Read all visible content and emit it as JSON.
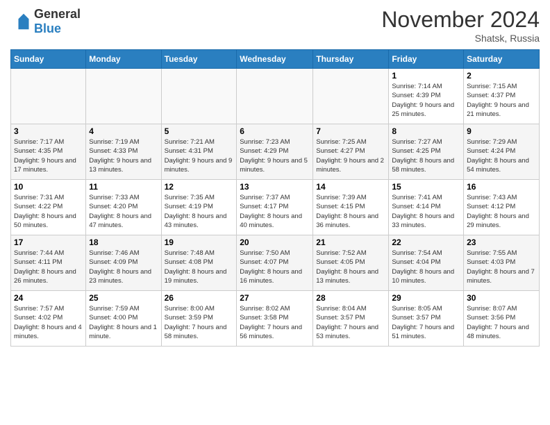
{
  "header": {
    "logo_general": "General",
    "logo_blue": "Blue",
    "month_title": "November 2024",
    "location": "Shatsk, Russia"
  },
  "days_of_week": [
    "Sunday",
    "Monday",
    "Tuesday",
    "Wednesday",
    "Thursday",
    "Friday",
    "Saturday"
  ],
  "weeks": [
    [
      {
        "day": "",
        "info": ""
      },
      {
        "day": "",
        "info": ""
      },
      {
        "day": "",
        "info": ""
      },
      {
        "day": "",
        "info": ""
      },
      {
        "day": "",
        "info": ""
      },
      {
        "day": "1",
        "info": "Sunrise: 7:14 AM\nSunset: 4:39 PM\nDaylight: 9 hours and 25 minutes."
      },
      {
        "day": "2",
        "info": "Sunrise: 7:15 AM\nSunset: 4:37 PM\nDaylight: 9 hours and 21 minutes."
      }
    ],
    [
      {
        "day": "3",
        "info": "Sunrise: 7:17 AM\nSunset: 4:35 PM\nDaylight: 9 hours and 17 minutes."
      },
      {
        "day": "4",
        "info": "Sunrise: 7:19 AM\nSunset: 4:33 PM\nDaylight: 9 hours and 13 minutes."
      },
      {
        "day": "5",
        "info": "Sunrise: 7:21 AM\nSunset: 4:31 PM\nDaylight: 9 hours and 9 minutes."
      },
      {
        "day": "6",
        "info": "Sunrise: 7:23 AM\nSunset: 4:29 PM\nDaylight: 9 hours and 5 minutes."
      },
      {
        "day": "7",
        "info": "Sunrise: 7:25 AM\nSunset: 4:27 PM\nDaylight: 9 hours and 2 minutes."
      },
      {
        "day": "8",
        "info": "Sunrise: 7:27 AM\nSunset: 4:25 PM\nDaylight: 8 hours and 58 minutes."
      },
      {
        "day": "9",
        "info": "Sunrise: 7:29 AM\nSunset: 4:24 PM\nDaylight: 8 hours and 54 minutes."
      }
    ],
    [
      {
        "day": "10",
        "info": "Sunrise: 7:31 AM\nSunset: 4:22 PM\nDaylight: 8 hours and 50 minutes."
      },
      {
        "day": "11",
        "info": "Sunrise: 7:33 AM\nSunset: 4:20 PM\nDaylight: 8 hours and 47 minutes."
      },
      {
        "day": "12",
        "info": "Sunrise: 7:35 AM\nSunset: 4:19 PM\nDaylight: 8 hours and 43 minutes."
      },
      {
        "day": "13",
        "info": "Sunrise: 7:37 AM\nSunset: 4:17 PM\nDaylight: 8 hours and 40 minutes."
      },
      {
        "day": "14",
        "info": "Sunrise: 7:39 AM\nSunset: 4:15 PM\nDaylight: 8 hours and 36 minutes."
      },
      {
        "day": "15",
        "info": "Sunrise: 7:41 AM\nSunset: 4:14 PM\nDaylight: 8 hours and 33 minutes."
      },
      {
        "day": "16",
        "info": "Sunrise: 7:43 AM\nSunset: 4:12 PM\nDaylight: 8 hours and 29 minutes."
      }
    ],
    [
      {
        "day": "17",
        "info": "Sunrise: 7:44 AM\nSunset: 4:11 PM\nDaylight: 8 hours and 26 minutes."
      },
      {
        "day": "18",
        "info": "Sunrise: 7:46 AM\nSunset: 4:09 PM\nDaylight: 8 hours and 23 minutes."
      },
      {
        "day": "19",
        "info": "Sunrise: 7:48 AM\nSunset: 4:08 PM\nDaylight: 8 hours and 19 minutes."
      },
      {
        "day": "20",
        "info": "Sunrise: 7:50 AM\nSunset: 4:07 PM\nDaylight: 8 hours and 16 minutes."
      },
      {
        "day": "21",
        "info": "Sunrise: 7:52 AM\nSunset: 4:05 PM\nDaylight: 8 hours and 13 minutes."
      },
      {
        "day": "22",
        "info": "Sunrise: 7:54 AM\nSunset: 4:04 PM\nDaylight: 8 hours and 10 minutes."
      },
      {
        "day": "23",
        "info": "Sunrise: 7:55 AM\nSunset: 4:03 PM\nDaylight: 8 hours and 7 minutes."
      }
    ],
    [
      {
        "day": "24",
        "info": "Sunrise: 7:57 AM\nSunset: 4:02 PM\nDaylight: 8 hours and 4 minutes."
      },
      {
        "day": "25",
        "info": "Sunrise: 7:59 AM\nSunset: 4:00 PM\nDaylight: 8 hours and 1 minute."
      },
      {
        "day": "26",
        "info": "Sunrise: 8:00 AM\nSunset: 3:59 PM\nDaylight: 7 hours and 58 minutes."
      },
      {
        "day": "27",
        "info": "Sunrise: 8:02 AM\nSunset: 3:58 PM\nDaylight: 7 hours and 56 minutes."
      },
      {
        "day": "28",
        "info": "Sunrise: 8:04 AM\nSunset: 3:57 PM\nDaylight: 7 hours and 53 minutes."
      },
      {
        "day": "29",
        "info": "Sunrise: 8:05 AM\nSunset: 3:57 PM\nDaylight: 7 hours and 51 minutes."
      },
      {
        "day": "30",
        "info": "Sunrise: 8:07 AM\nSunset: 3:56 PM\nDaylight: 7 hours and 48 minutes."
      }
    ]
  ]
}
